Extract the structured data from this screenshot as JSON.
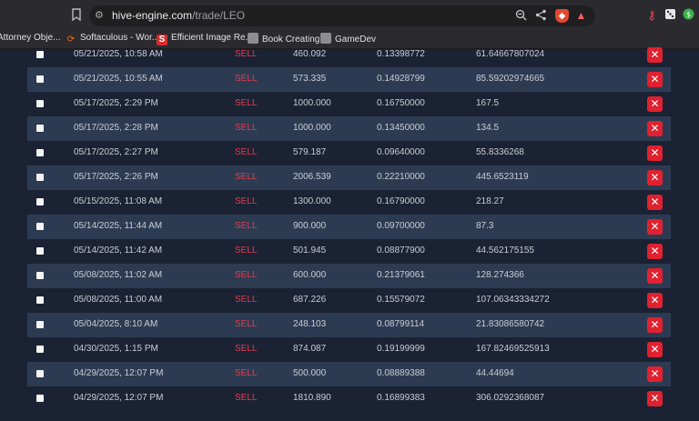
{
  "browser": {
    "url_host": "hive-engine.com",
    "url_path": "/trade/LEO",
    "bookmarks": [
      {
        "label": "Attorney Obje..."
      },
      {
        "label": "Softaculous - Wor..."
      },
      {
        "label": "Efficient Image Re..."
      },
      {
        "label": "Book Creating"
      },
      {
        "label": "GameDev"
      }
    ],
    "icons": [
      "bookmark-icon",
      "site-settings-icon",
      "zoom-icon",
      "share-icon",
      "brave-shields-icon",
      "brave-rewards-icon",
      "extension-key-icon",
      "extension-dice-icon",
      "extension-green-icon"
    ]
  },
  "orders": [
    {
      "date": "05/21/2025, 10:58 AM",
      "type": "SELL",
      "quantity": "460.092",
      "price": "0.13398772",
      "total": "61.64667807024"
    },
    {
      "date": "05/21/2025, 10:55 AM",
      "type": "SELL",
      "quantity": "573.335",
      "price": "0.14928799",
      "total": "85.59202974665"
    },
    {
      "date": "05/17/2025, 2:29 PM",
      "type": "SELL",
      "quantity": "1000.000",
      "price": "0.16750000",
      "total": "167.5"
    },
    {
      "date": "05/17/2025, 2:28 PM",
      "type": "SELL",
      "quantity": "1000.000",
      "price": "0.13450000",
      "total": "134.5"
    },
    {
      "date": "05/17/2025, 2:27 PM",
      "type": "SELL",
      "quantity": "579.187",
      "price": "0.09640000",
      "total": "55.8336268"
    },
    {
      "date": "05/17/2025, 2:26 PM",
      "type": "SELL",
      "quantity": "2006.539",
      "price": "0.22210000",
      "total": "445.6523119"
    },
    {
      "date": "05/15/2025, 11:08 AM",
      "type": "SELL",
      "quantity": "1300.000",
      "price": "0.16790000",
      "total": "218.27"
    },
    {
      "date": "05/14/2025, 11:44 AM",
      "type": "SELL",
      "quantity": "900.000",
      "price": "0.09700000",
      "total": "87.3"
    },
    {
      "date": "05/14/2025, 11:42 AM",
      "type": "SELL",
      "quantity": "501.945",
      "price": "0.08877900",
      "total": "44.562175155"
    },
    {
      "date": "05/08/2025, 11:02 AM",
      "type": "SELL",
      "quantity": "600.000",
      "price": "0.21379061",
      "total": "128.274366"
    },
    {
      "date": "05/08/2025, 11:00 AM",
      "type": "SELL",
      "quantity": "687.226",
      "price": "0.15579072",
      "total": "107.06343334272"
    },
    {
      "date": "05/04/2025, 8:10 AM",
      "type": "SELL",
      "quantity": "248.103",
      "price": "0.08799114",
      "total": "21.83086580742"
    },
    {
      "date": "04/30/2025, 1:15 PM",
      "type": "SELL",
      "quantity": "874.087",
      "price": "0.19199999",
      "total": "167.82469525913"
    },
    {
      "date": "04/29/2025, 12:07 PM",
      "type": "SELL",
      "quantity": "500.000",
      "price": "0.08889388",
      "total": "44.44694"
    },
    {
      "date": "04/29/2025, 12:07 PM",
      "type": "SELL",
      "quantity": "1810.890",
      "price": "0.16899383",
      "total": "306.0292368087"
    }
  ],
  "colors": {
    "sell": "#e33d4b",
    "cancel": "#e0212f",
    "row_alt": "#2d3b52",
    "background": "#1b2234"
  }
}
